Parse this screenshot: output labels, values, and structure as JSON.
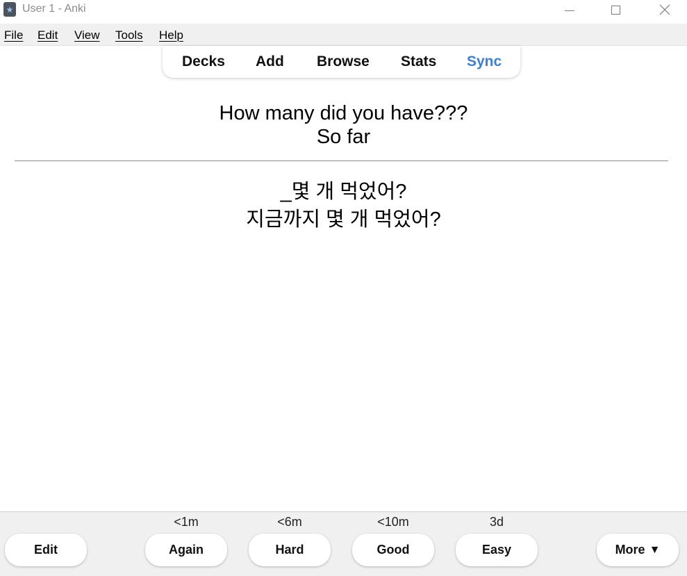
{
  "window": {
    "title": "User 1 - Anki"
  },
  "menubar": {
    "items": [
      "File",
      "Edit",
      "View",
      "Tools",
      "Help"
    ]
  },
  "topnav": {
    "links": [
      "Decks",
      "Add",
      "Browse",
      "Stats",
      "Sync"
    ],
    "accent_color": "#3b7fdb"
  },
  "card": {
    "front_lines": [
      "How many did you have???",
      "So far"
    ],
    "back_lines": [
      "_몇 개 먹었어?",
      "지금까지 몇 개 먹었어?"
    ]
  },
  "answer_bar": {
    "edit_label": "Edit",
    "buttons": [
      {
        "label": "Again",
        "interval": "<1m"
      },
      {
        "label": "Hard",
        "interval": "<6m"
      },
      {
        "label": "Good",
        "interval": "<10m"
      },
      {
        "label": "Easy",
        "interval": "3d"
      }
    ],
    "more_label": "More",
    "more_arrow": "▼"
  },
  "icons": {
    "app": "anki-star-icon",
    "minimize": "minimize-icon",
    "maximize": "maximize-icon",
    "close": "close-icon"
  }
}
